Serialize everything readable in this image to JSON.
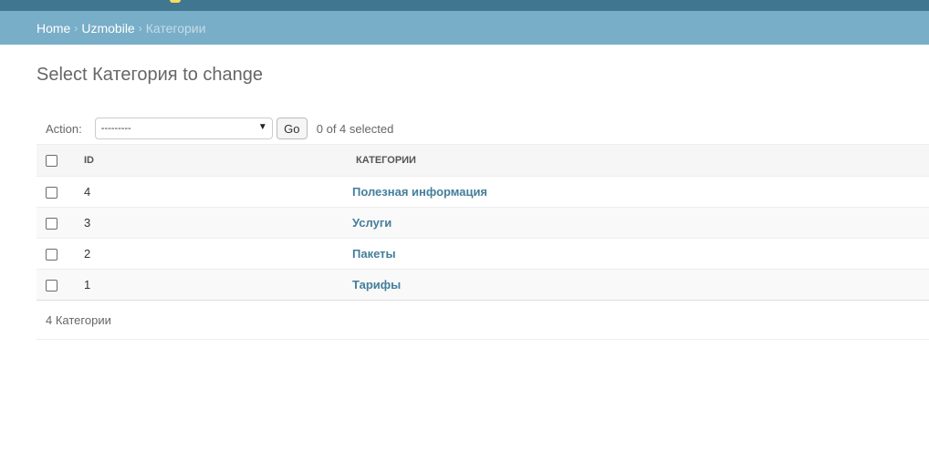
{
  "breadcrumbs": {
    "home": "Home",
    "app": "Uzmobile",
    "current": "Категории",
    "separator": "›"
  },
  "page_title": "Select Категория to change",
  "actions": {
    "label": "Action:",
    "selected_option": "---------",
    "go_label": "Go",
    "selected_count": "0 of 4 selected"
  },
  "table": {
    "headers": [
      "ID",
      "КАТЕГОРИИ"
    ],
    "rows": [
      {
        "id": "4",
        "name": "Полезная информация"
      },
      {
        "id": "3",
        "name": "Услуги"
      },
      {
        "id": "2",
        "name": "Пакеты"
      },
      {
        "id": "1",
        "name": "Тарифы"
      }
    ]
  },
  "paginator": "4 Категории",
  "colors": {
    "header": "#417690",
    "breadcrumbs": "#79aec8",
    "link": "#447e9b"
  }
}
